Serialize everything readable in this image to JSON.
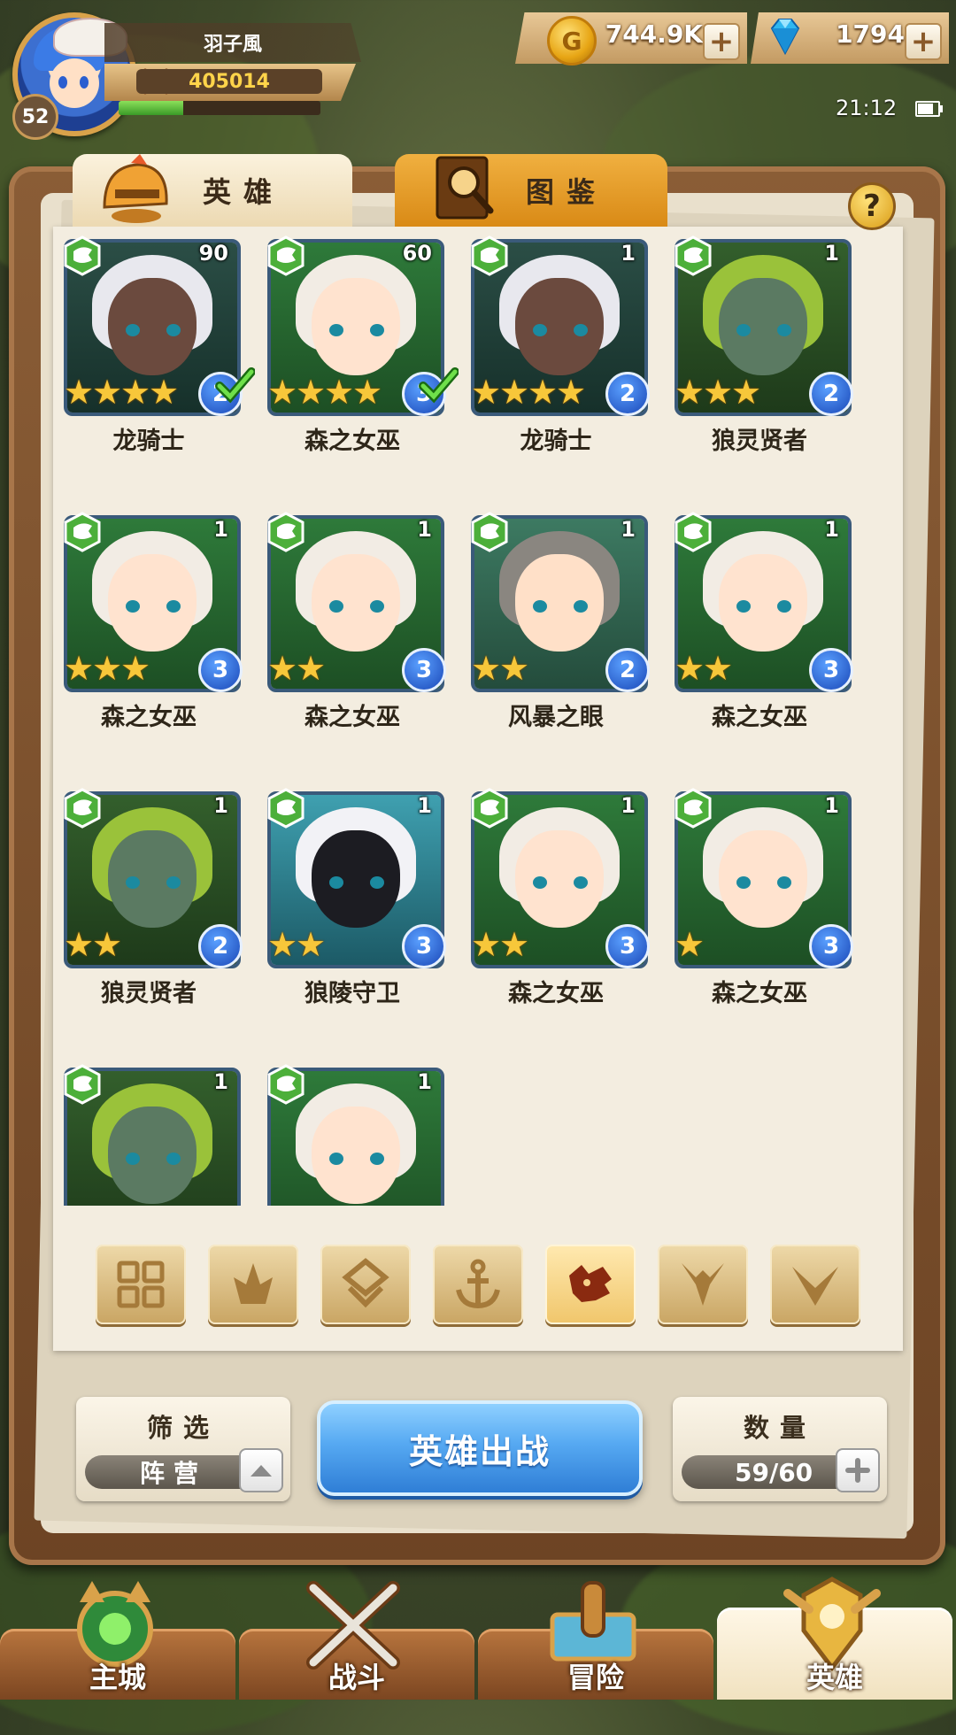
{
  "player": {
    "name": "羽子風",
    "level": "52",
    "power": "405014",
    "xp_fraction": 0.32
  },
  "resources": {
    "gold": "744.9K",
    "gems": "1794"
  },
  "status": {
    "time": "21:12"
  },
  "tabs": {
    "heroes": "英雄",
    "codex": "图鉴"
  },
  "heroes": [
    {
      "name": "龙骑士",
      "level": "90",
      "stars": 4,
      "rank": "2",
      "checked": true,
      "art": "dark-elf"
    },
    {
      "name": "森之女巫",
      "level": "60",
      "stars": 4,
      "rank": "3",
      "checked": true,
      "art": "witch"
    },
    {
      "name": "龙骑士",
      "level": "1",
      "stars": 4,
      "rank": "2",
      "checked": false,
      "art": "dark-elf"
    },
    {
      "name": "狼灵贤者",
      "level": "1",
      "stars": 3,
      "rank": "2",
      "checked": false,
      "art": "owl"
    },
    {
      "name": "森之女巫",
      "level": "1",
      "stars": 3,
      "rank": "3",
      "checked": false,
      "art": "witch"
    },
    {
      "name": "森之女巫",
      "level": "1",
      "stars": 2,
      "rank": "3",
      "checked": false,
      "art": "witch"
    },
    {
      "name": "风暴之眼",
      "level": "1",
      "stars": 2,
      "rank": "2",
      "checked": false,
      "art": "boy"
    },
    {
      "name": "森之女巫",
      "level": "1",
      "stars": 2,
      "rank": "3",
      "checked": false,
      "art": "witch"
    },
    {
      "name": "狼灵贤者",
      "level": "1",
      "stars": 2,
      "rank": "2",
      "checked": false,
      "art": "owl"
    },
    {
      "name": "狼陵守卫",
      "level": "1",
      "stars": 2,
      "rank": "3",
      "checked": false,
      "art": "wolf"
    },
    {
      "name": "森之女巫",
      "level": "1",
      "stars": 2,
      "rank": "3",
      "checked": false,
      "art": "witch"
    },
    {
      "name": "森之女巫",
      "level": "1",
      "stars": 1,
      "rank": "3",
      "checked": false,
      "art": "witch"
    },
    {
      "name": "",
      "level": "1",
      "stars": 0,
      "rank": "",
      "checked": false,
      "art": "owl"
    },
    {
      "name": "",
      "level": "1",
      "stars": 0,
      "rank": "",
      "checked": false,
      "art": "witch"
    }
  ],
  "filter_icons": [
    "grid-icon",
    "flame-icon",
    "diamond-icon",
    "anchor-icon",
    "wolf-head-icon",
    "horned-mask-icon",
    "chevron-wing-icon"
  ],
  "filter_active_index": 4,
  "controls": {
    "filter_title": "筛选",
    "filter_value": "阵营",
    "deploy_label": "英雄出战",
    "count_title": "数量",
    "count_value": "59/60"
  },
  "nav": [
    {
      "label": "主城",
      "icon": "castle-icon"
    },
    {
      "label": "战斗",
      "icon": "crossed-swords-icon"
    },
    {
      "label": "冒险",
      "icon": "map-scroll-icon"
    },
    {
      "label": "英雄",
      "icon": "hero-crest-icon"
    }
  ],
  "nav_active_index": 3,
  "colors": {
    "accent_gold": "#f0c66b",
    "deploy_blue": "#56a9f2",
    "faction_green": "#4caf3a"
  }
}
